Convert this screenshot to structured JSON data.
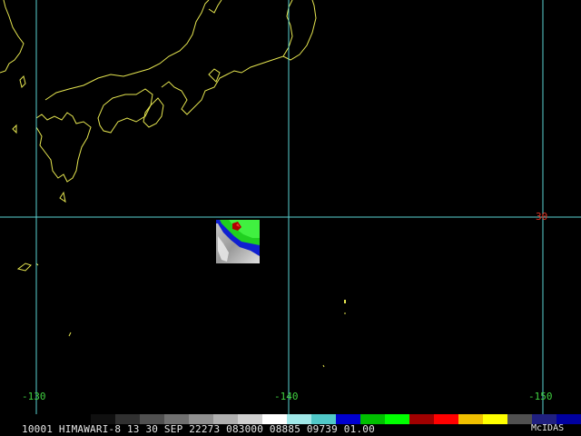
{
  "map": {
    "latitude_label": "30",
    "longitude_labels": [
      "-130",
      "-140",
      "-150"
    ],
    "grid_color": "#5ad2d2",
    "coast_color": "#e6e650",
    "lat_label_color": "#e03020",
    "lon_label_color": "#40d040"
  },
  "footer": {
    "caption": "10001 HIMAWARI-8 13 30 SEP 22273 083000 08885 09739 01.00",
    "brand": "McIDAS"
  },
  "colorbar": {
    "segments": [
      "#101010",
      "#303030",
      "#505050",
      "#707070",
      "#909090",
      "#b0b0b0",
      "#d0d0d0",
      "#ffffff",
      "#a0e8e8",
      "#50c8c8",
      "#0000d0",
      "#00c000",
      "#00ff00",
      "#a00000",
      "#ff0000",
      "#f0c000",
      "#ffff00",
      "#505050",
      "#202080",
      "#0000a0"
    ]
  }
}
